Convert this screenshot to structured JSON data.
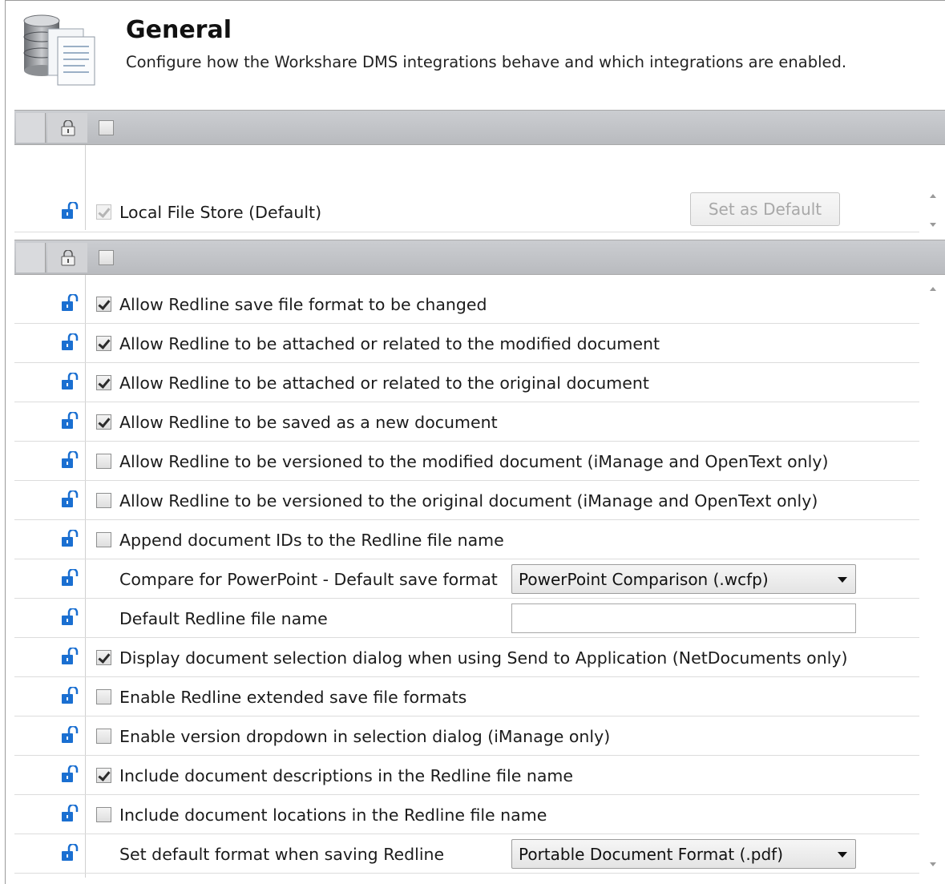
{
  "header": {
    "title": "General",
    "description": "Configure how the Workshare DMS integrations behave and which integrations are enabled.",
    "icon": "database-documents-icon"
  },
  "integrations": {
    "items": [
      {
        "label": "Local File Store  (Default)",
        "checked": true,
        "disabled": true
      }
    ],
    "set_default_label": "Set as Default"
  },
  "settings": {
    "rows": [
      {
        "label": "Allow Redline save file format to be changed",
        "type": "checkbox",
        "checked": true
      },
      {
        "label": "Allow Redline to be attached or related to the modified document",
        "type": "checkbox",
        "checked": true
      },
      {
        "label": "Allow Redline to be attached or related to the original document",
        "type": "checkbox",
        "checked": true
      },
      {
        "label": "Allow Redline to be saved as a new document",
        "type": "checkbox",
        "checked": true
      },
      {
        "label": "Allow Redline to be versioned to the modified document (iManage and OpenText only)",
        "type": "checkbox",
        "checked": false
      },
      {
        "label": "Allow Redline to be versioned to the original document (iManage and OpenText only)",
        "type": "checkbox",
        "checked": false
      },
      {
        "label": "Append document IDs to the Redline file name",
        "type": "checkbox",
        "checked": false
      },
      {
        "label": "Compare for PowerPoint - Default save format",
        "type": "select",
        "value": "PowerPoint Comparison (.wcfp)"
      },
      {
        "label": "Default Redline file name",
        "type": "text",
        "value": ""
      },
      {
        "label": "Display document selection dialog when using Send to Application (NetDocuments only)",
        "type": "checkbox",
        "checked": true
      },
      {
        "label": "Enable Redline extended save file formats",
        "type": "checkbox",
        "checked": false
      },
      {
        "label": "Enable version dropdown in selection dialog (iManage only)",
        "type": "checkbox",
        "checked": false
      },
      {
        "label": "Include document descriptions in the Redline file name",
        "type": "checkbox",
        "checked": true
      },
      {
        "label": "Include document locations in the Redline file name",
        "type": "checkbox",
        "checked": false
      },
      {
        "label": "Set default format when saving Redline",
        "type": "select",
        "value": "Portable Document Format (.pdf)"
      }
    ]
  },
  "colors": {
    "lock_blue": "#1a6fd1",
    "group_bar": "#c2c4c8"
  }
}
